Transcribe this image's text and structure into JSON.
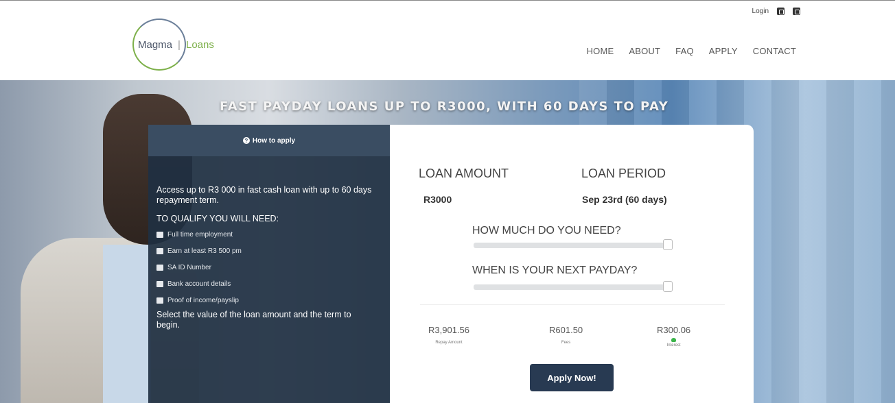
{
  "header": {
    "logo": {
      "word1": "Magma",
      "word2": "Loans"
    },
    "top_links": {
      "login": "Login"
    },
    "nav": [
      "HOME",
      "ABOUT",
      "FAQ",
      "APPLY",
      "CONTACT"
    ]
  },
  "hero": {
    "title": "FAST PAYDAY LOANS UP TO R3000, WITH 60 DAYS TO PAY"
  },
  "how_to_apply": {
    "heading": "How to apply",
    "intro": "Access up to R3 000 in fast cash loan with up to 60 days repayment term.",
    "qualify_heading": "TO QUALIFY YOU WILL NEED:",
    "requirements": [
      "Full time employment",
      "Earn at least R3 500 pm",
      "SA ID Number",
      "Bank account details",
      "Proof of income/payslip"
    ],
    "outro": "Select the value of the loan amount and the term to begin."
  },
  "calculator": {
    "loan_amount_label": "LOAN AMOUNT",
    "loan_period_label": "LOAN PERIOD",
    "loan_amount_value": "R3000",
    "loan_period_value": "Sep 23rd (60 days)",
    "q_amount": "HOW MUCH DO YOU NEED?",
    "q_payday": "WHEN IS YOUR NEXT PAYDAY?",
    "amount_slider_fraction": 1.0,
    "payday_slider_fraction": 1.0,
    "repay": {
      "value": "R3,901.56",
      "caption": "Repay Amount"
    },
    "fees": {
      "value": "R601.50",
      "caption": "Fees"
    },
    "interest": {
      "value": "R300.06",
      "caption": "Interest"
    },
    "apply_label": "Apply Now!"
  },
  "colors": {
    "brand_dark": "#283a52",
    "brand_green": "#7db04a",
    "panel_dark": "#203042"
  }
}
